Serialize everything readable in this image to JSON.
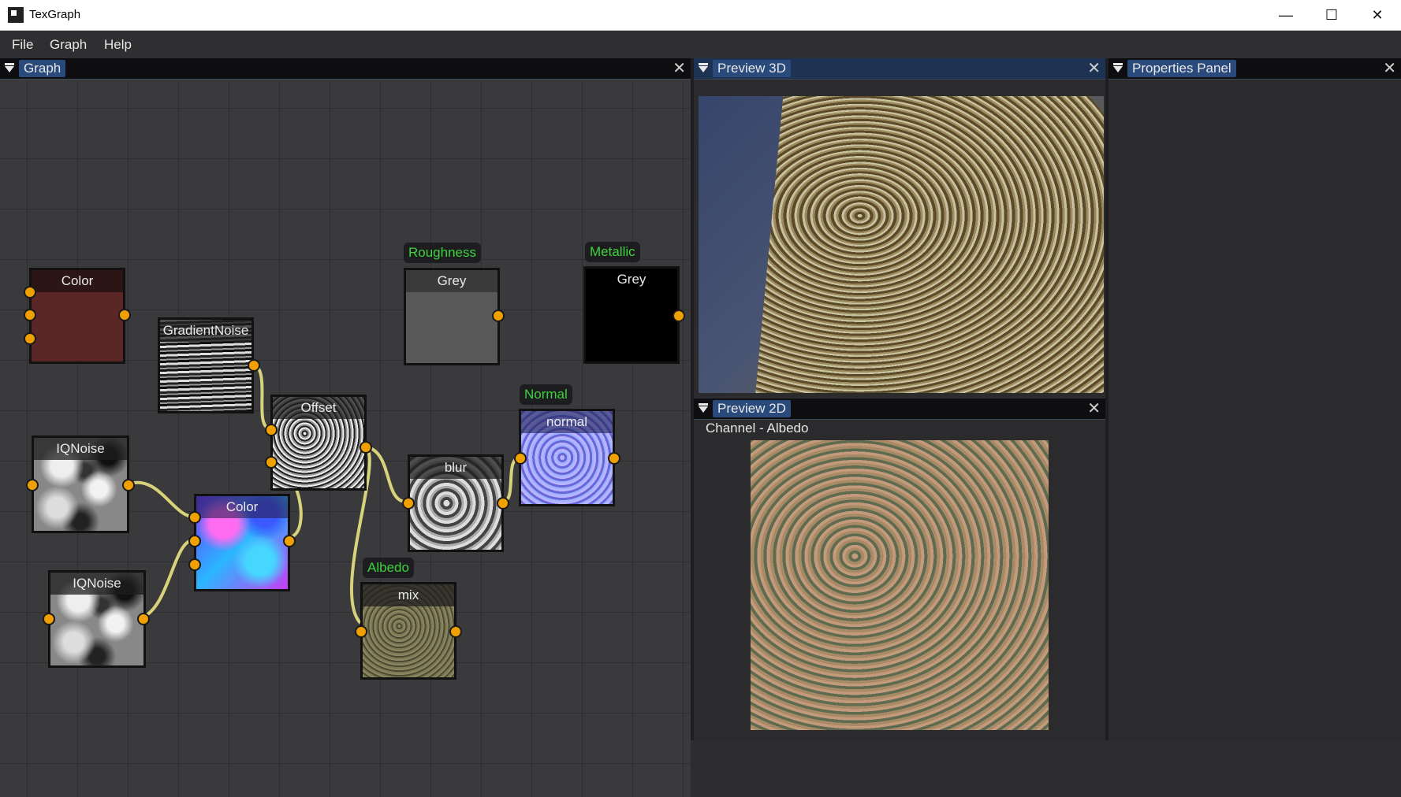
{
  "window": {
    "title": "TexGraph",
    "minimize_glyph": "—",
    "maximize_glyph": "☐",
    "close_glyph": "✕"
  },
  "menu": {
    "items": [
      "File",
      "Graph",
      "Help"
    ]
  },
  "panels": {
    "graph": {
      "title": "Graph"
    },
    "preview3d": {
      "title": "Preview 3D"
    },
    "preview2d": {
      "title": "Preview 2D",
      "channel": "Channel - Albedo"
    },
    "properties": {
      "title": "Properties Panel"
    },
    "close_glyph": "✕"
  },
  "nodes": {
    "color1": {
      "title": "Color",
      "swatch": "#5a2626"
    },
    "gradient_noise": {
      "title": "GradientNoise"
    },
    "iqnoise1": {
      "title": "IQNoise"
    },
    "iqnoise2": {
      "title": "IQNoise"
    },
    "color2": {
      "title": "Color"
    },
    "offset": {
      "title": "Offset"
    },
    "blur": {
      "title": "blur"
    },
    "normal": {
      "title": "normal"
    },
    "roughness_grey": {
      "title": "Grey",
      "swatch": "#595959"
    },
    "metallic_grey": {
      "title": "Grey",
      "swatch": "#000000"
    },
    "mix": {
      "title": "mix"
    }
  },
  "outputs": {
    "roughness": "Roughness",
    "metallic": "Metallic",
    "normal": "Normal",
    "albedo": "Albedo"
  },
  "colors": {
    "pin": "#f0a000",
    "wire": "#d8d27a",
    "output_label": "#3ed23e",
    "tab_active": "#294a7a"
  }
}
